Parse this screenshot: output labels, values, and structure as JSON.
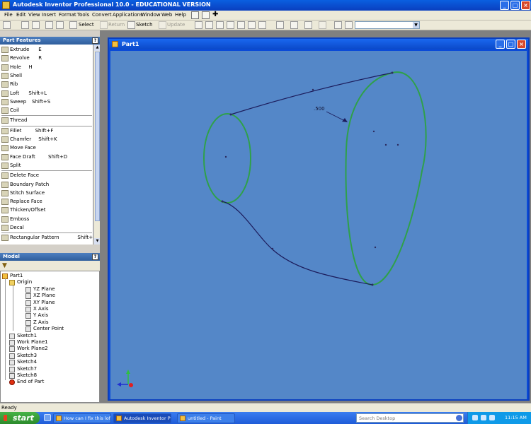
{
  "window": {
    "title": "Autodesk Inventor Professional 10.0 - EDUCATIONAL VERSION"
  },
  "menu": [
    "File",
    "Edit",
    "View",
    "Insert",
    "Format",
    "Tools",
    "Convert",
    "Applications",
    "Window",
    "Web",
    "Help"
  ],
  "toolbar": {
    "select_label": "Select",
    "return_label": "Return",
    "sketch_label": "Sketch",
    "update_label": "Update"
  },
  "features_panel": {
    "title": "Part Features",
    "items": [
      {
        "label": "Extrude",
        "key": "E"
      },
      {
        "label": "Revolve",
        "key": "R"
      },
      {
        "label": "Hole",
        "key": "H"
      },
      {
        "label": "Shell",
        "key": ""
      },
      {
        "label": "Rib",
        "key": ""
      },
      {
        "label": "Loft",
        "key": "Shift+L"
      },
      {
        "label": "Sweep",
        "key": "Shift+S"
      },
      {
        "label": "Coil",
        "key": ""
      },
      {
        "label": "Thread",
        "key": ""
      },
      {
        "label": "Fillet",
        "key": "Shift+F"
      },
      {
        "label": "Chamfer",
        "key": "Shift+K"
      },
      {
        "label": "Move Face",
        "key": ""
      },
      {
        "label": "Face Draft",
        "key": "Shift+D"
      },
      {
        "label": "Split",
        "key": ""
      },
      {
        "label": "Delete Face",
        "key": ""
      },
      {
        "label": "Boundary Patch",
        "key": ""
      },
      {
        "label": "Stitch Surface",
        "key": ""
      },
      {
        "label": "Replace Face",
        "key": ""
      },
      {
        "label": "Thicken/Offset",
        "key": ""
      },
      {
        "label": "Emboss",
        "key": ""
      },
      {
        "label": "Decal",
        "key": ""
      },
      {
        "label": "Rectangular Pattern",
        "key": "Shift+R"
      }
    ]
  },
  "model_panel": {
    "title": "Model",
    "tree": [
      {
        "label": "Part1",
        "indent": 0,
        "kind": "part"
      },
      {
        "label": "Origin",
        "indent": 1,
        "kind": "folder"
      },
      {
        "label": "YZ Plane",
        "indent": 2,
        "kind": "plane"
      },
      {
        "label": "XZ Plane",
        "indent": 2,
        "kind": "plane"
      },
      {
        "label": "XY Plane",
        "indent": 2,
        "kind": "plane"
      },
      {
        "label": "X Axis",
        "indent": 2,
        "kind": "axis"
      },
      {
        "label": "Y Axis",
        "indent": 2,
        "kind": "axis"
      },
      {
        "label": "Z Axis",
        "indent": 2,
        "kind": "axis"
      },
      {
        "label": "Center Point",
        "indent": 2,
        "kind": "point"
      },
      {
        "label": "Sketch1",
        "indent": 1,
        "kind": "sketch"
      },
      {
        "label": "Work Plane1",
        "indent": 1,
        "kind": "plane"
      },
      {
        "label": "Work Plane2",
        "indent": 1,
        "kind": "plane"
      },
      {
        "label": "Sketch3",
        "indent": 1,
        "kind": "sketch"
      },
      {
        "label": "Sketch4",
        "indent": 1,
        "kind": "sketch"
      },
      {
        "label": "Sketch7",
        "indent": 1,
        "kind": "sketch"
      },
      {
        "label": "Sketch8",
        "indent": 1,
        "kind": "sketch"
      },
      {
        "label": "End of Part",
        "indent": 1,
        "kind": "end"
      }
    ]
  },
  "document": {
    "title": "Part1",
    "dimension_label": ".500"
  },
  "status": {
    "text": "Ready"
  },
  "taskbar": {
    "start_label": "start",
    "tasks": [
      {
        "label": "How can I fix this loft...",
        "active": false
      },
      {
        "label": "Autodesk Inventor Pr...",
        "active": true
      },
      {
        "label": "untitled - Paint",
        "active": false
      }
    ],
    "search_placeholder": "Search Desktop",
    "clock": "11:15 AM"
  },
  "colors": {
    "canvas_bg": "#5487c8",
    "profile_green": "#2fa04a",
    "rail_navy": "#1c1c5c"
  }
}
